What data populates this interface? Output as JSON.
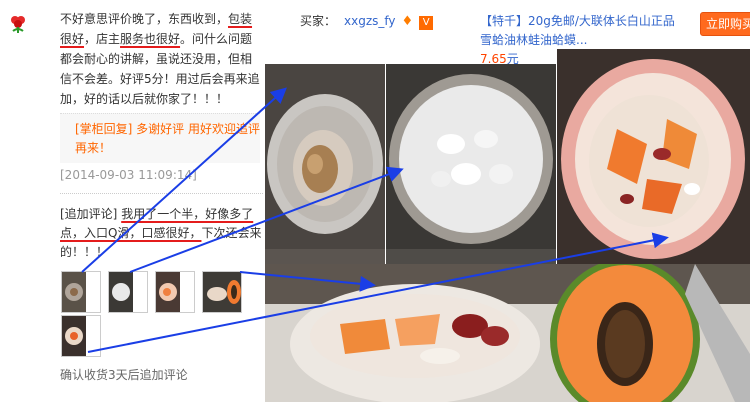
{
  "review": {
    "text_a": "不好意思评价晚了，东西收到，",
    "text_b": "包装很好",
    "text_c": "，店主",
    "text_d": "服务也很好",
    "text_e": "。问什么问题都会耐心的讲解，虽说还没用，但相信不会差。好评5分！用过后会再来追加，好的话以后就你家了！！！",
    "reply": "[掌柜回复] 多谢好评 用好欢迎追评 再来！",
    "time": "[2014-09-03 11:09:14]",
    "followup_tag": "[追加评论]",
    "followup_u1": "我用了一个半，好像多了点，入口Q滑，口感很好，",
    "followup_rest": "下次还会来的！！！",
    "confirm": "确认收货3天后追加评论"
  },
  "buyer": {
    "label": "买家：",
    "name": "xxgzs_fy",
    "vip_icon": "V"
  },
  "product": {
    "title": "【特千】20g免邮/大联体长白山正品雪蛤油林蛙油蛤蟆...",
    "price": "7.65",
    "currency": "元"
  },
  "buy_button": "立即购买",
  "colors": {
    "accent": "#ff6a1e",
    "link": "#3366cc",
    "reply": "#ff6600",
    "arrow": "#1a3ee6",
    "underline": "#e41c1c"
  }
}
